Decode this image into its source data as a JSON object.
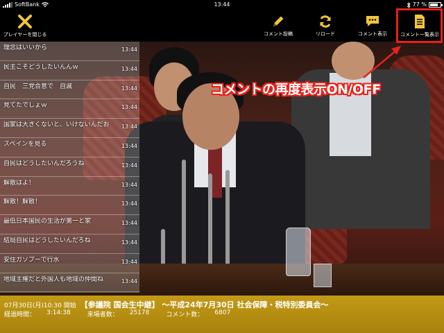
{
  "status_bar": {
    "carrier": "SoftBank",
    "time": "13:44",
    "battery_percent": "77 %",
    "battery_level": 0.77
  },
  "toolbar": {
    "close_label": "プレイヤーを閉じる",
    "post_label": "コメント投稿",
    "reload_label": "リロード",
    "show_label": "コメント表示",
    "list_label": "コメント一覧表示",
    "accent_color": "#f2c63a",
    "highlight_color": "#e8211b"
  },
  "comments": [
    {
      "text": "理念はいいから",
      "time": "13:44"
    },
    {
      "text": "民主こそどうしたいんんｗ",
      "time": "13:44"
    },
    {
      "text": "自民　三党合意で　自滅",
      "time": "13:44"
    },
    {
      "text": "見てたでしょｗ",
      "time": "13:44"
    },
    {
      "text": "国家は大きくないと、いけないんだお",
      "time": "13:44"
    },
    {
      "text": "スペインを見る",
      "time": "13:44"
    },
    {
      "text": "自民はどうしたいんだろうね",
      "time": "13:44"
    },
    {
      "text": "解散はよ！",
      "time": "13:44"
    },
    {
      "text": "解散！解散！",
      "time": "13:44"
    },
    {
      "text": "最低日本国民の生活が第一と家",
      "time": "13:44"
    },
    {
      "text": "結局自民はどうしたいんだろね",
      "time": "13:44"
    },
    {
      "text": "安住ガソプーで行水",
      "time": "13:44"
    },
    {
      "text": "地域主権だと外国人も地域の仲間ね",
      "time": "13:44"
    }
  ],
  "annotation": {
    "text": "コメントの再度表示ON/OFF"
  },
  "info": {
    "start": "07月30日(月)10:30 開始",
    "title": "【参議院 国会生中継】 〜平成24年7月30日 社会保障・税特別委員会〜",
    "elapsed_label": "経過時間：",
    "elapsed_value": "3:14:38",
    "visitors_label": "来場者数：",
    "visitors_value": "25178",
    "comments_label": "コメント数：",
    "comments_value": "6807"
  }
}
